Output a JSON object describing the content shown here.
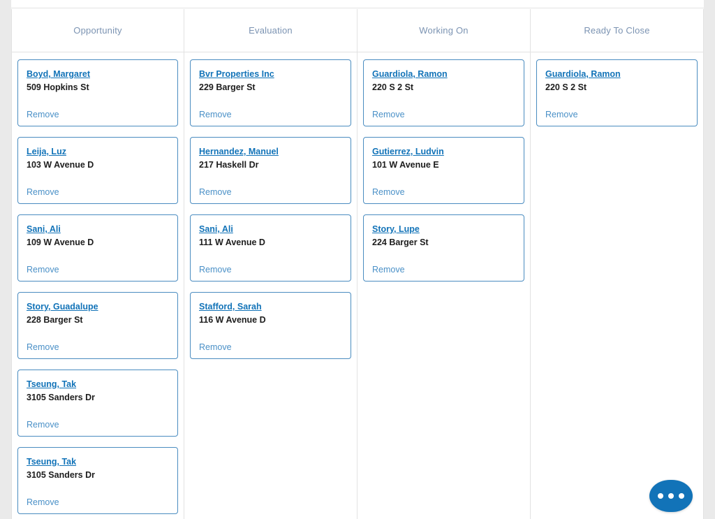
{
  "board": {
    "columns": [
      {
        "id": "opportunity",
        "title": "Opportunity",
        "cards": [
          {
            "name": "Boyd, Margaret",
            "address": "509 Hopkins St",
            "remove_label": "Remove"
          },
          {
            "name": "Leija, Luz",
            "address": "103 W Avenue D",
            "remove_label": "Remove"
          },
          {
            "name": "Sani, Ali",
            "address": "109 W Avenue D",
            "remove_label": "Remove"
          },
          {
            "name": "Story, Guadalupe",
            "address": "228 Barger St",
            "remove_label": "Remove"
          },
          {
            "name": "Tseung, Tak",
            "address": "3105 Sanders Dr",
            "remove_label": "Remove"
          },
          {
            "name": "Tseung, Tak",
            "address": "3105 Sanders Dr",
            "remove_label": "Remove"
          }
        ]
      },
      {
        "id": "evaluation",
        "title": "Evaluation",
        "cards": [
          {
            "name": "Bvr Properties Inc",
            "address": "229 Barger St",
            "remove_label": "Remove"
          },
          {
            "name": "Hernandez, Manuel",
            "address": "217 Haskell Dr",
            "remove_label": "Remove"
          },
          {
            "name": "Sani, Ali",
            "address": "111 W Avenue D",
            "remove_label": "Remove"
          },
          {
            "name": "Stafford, Sarah",
            "address": "116 W Avenue D",
            "remove_label": "Remove"
          }
        ]
      },
      {
        "id": "working-on",
        "title": "Working On",
        "cards": [
          {
            "name": "Guardiola, Ramon",
            "address": "220 S 2 St",
            "remove_label": "Remove"
          },
          {
            "name": "Gutierrez, Ludvin",
            "address": "101 W Avenue E",
            "remove_label": "Remove"
          },
          {
            "name": "Story, Lupe",
            "address": "224 Barger St",
            "remove_label": "Remove"
          }
        ]
      },
      {
        "id": "ready-to-close",
        "title": "Ready To Close",
        "cards": [
          {
            "name": "Guardiola, Ramon",
            "address": "220 S 2 St",
            "remove_label": "Remove"
          }
        ]
      }
    ]
  },
  "fab": {
    "icon": "ellipsis-icon",
    "dots": 3
  },
  "colors": {
    "link": "#1273b8",
    "card_border": "#4a8cc0",
    "header_text": "#7b93b2",
    "remove_link": "#4a90c7",
    "fab_background": "#1273b8",
    "page_background": "#eaeaea",
    "divider": "#e2e2e2"
  }
}
